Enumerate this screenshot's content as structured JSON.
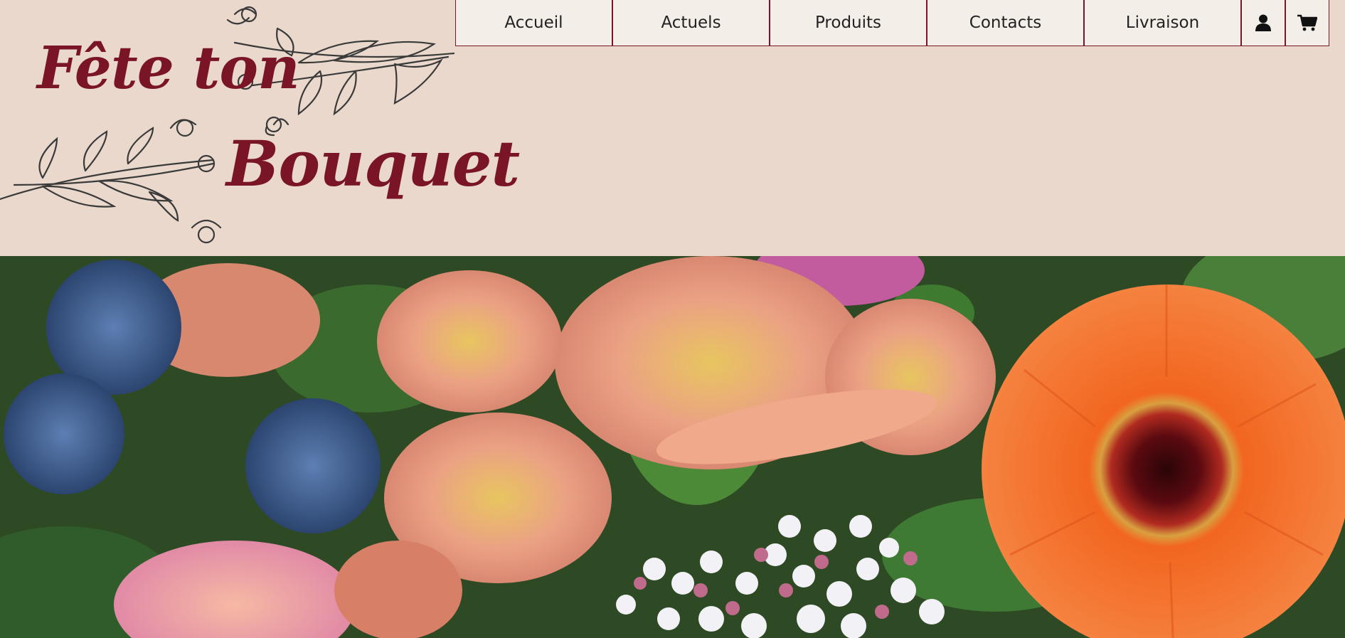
{
  "brand": {
    "line1": "Fête ton",
    "line2": "Bouquet"
  },
  "nav": {
    "items": [
      {
        "label": "Accueil"
      },
      {
        "label": "Actuels"
      },
      {
        "label": "Produits"
      },
      {
        "label": "Contacts"
      },
      {
        "label": "Livraison"
      }
    ],
    "icons": [
      "user-icon",
      "cart-icon"
    ]
  },
  "hero": {
    "image": "flower-bouquet-photo"
  },
  "colors": {
    "background": "#e9d8cb",
    "brand": "#7a1427",
    "nav_bg": "#f3eee7",
    "nav_border": "#7a1427"
  }
}
